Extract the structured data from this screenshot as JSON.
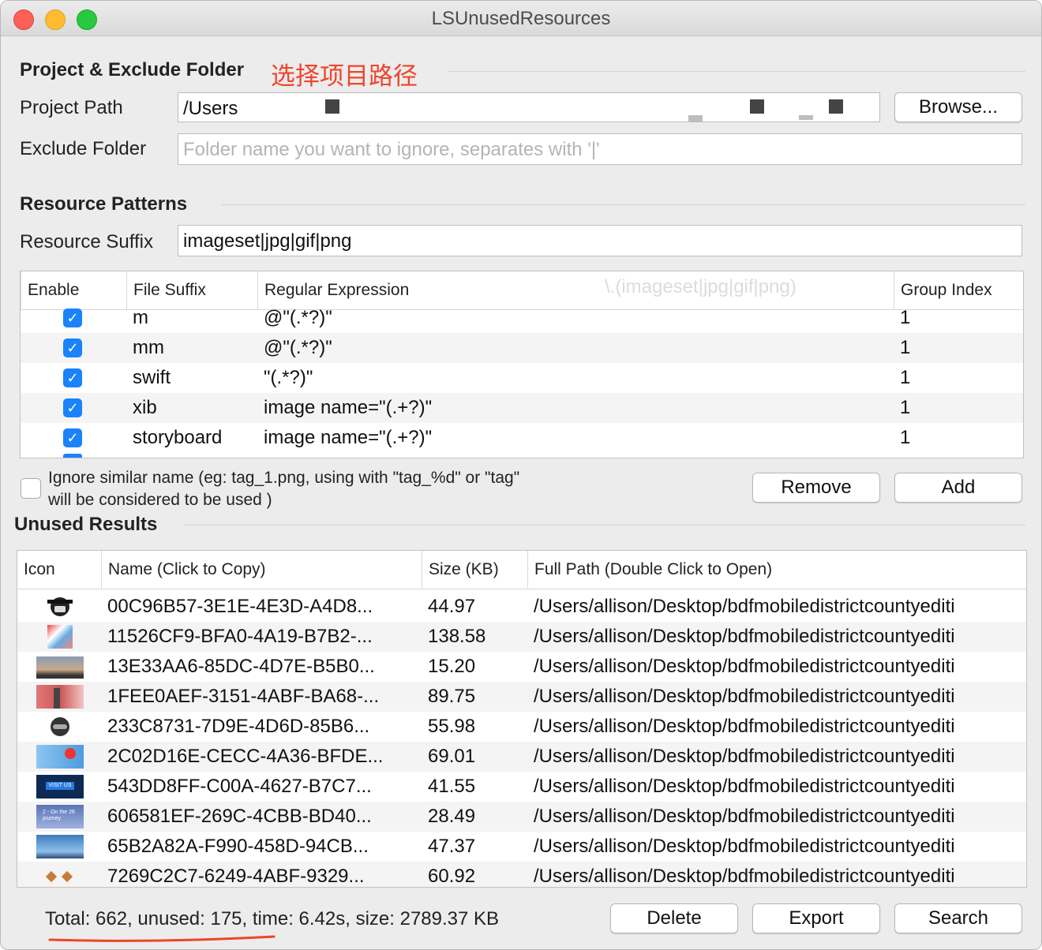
{
  "window": {
    "title": "LSUnusedResources"
  },
  "project": {
    "section_title": "Project & Exclude Folder",
    "annotation": "选择项目路径",
    "project_path_label": "Project Path",
    "project_path_value": "/Users",
    "browse_label": "Browse...",
    "exclude_label": "Exclude Folder",
    "exclude_placeholder": "Folder name you want to ignore, separates with '|'"
  },
  "patterns": {
    "section_title": "Resource Patterns",
    "suffix_label": "Resource Suffix",
    "suffix_value": "imageset|jpg|gif|png",
    "columns": [
      "Enable",
      "File Suffix",
      "Regular Expression",
      "Group Index"
    ],
    "header_ghost": "\\.(imageset|jpg|gif|png)",
    "rows": [
      {
        "enabled": true,
        "suffix": "m",
        "regex": "@\"(.*?)\"",
        "group": "1"
      },
      {
        "enabled": true,
        "suffix": "mm",
        "regex": "@\"(.*?)\"",
        "group": "1"
      },
      {
        "enabled": true,
        "suffix": "swift",
        "regex": "\"(.*?)\"",
        "group": "1"
      },
      {
        "enabled": true,
        "suffix": "xib",
        "regex": "image name=\"(.+?)\"",
        "group": "1"
      },
      {
        "enabled": true,
        "suffix": "storyboard",
        "regex": "image name=\"(.+?)\"",
        "group": "1"
      }
    ],
    "ignore_similar_line1": "Ignore similar name (eg: tag_1.png, using with \"tag_%d\" or \"tag\"",
    "ignore_similar_line2": "will be considered to be used )",
    "remove_label": "Remove",
    "add_label": "Add"
  },
  "results": {
    "section_title": "Unused Results",
    "columns": [
      "Icon",
      "Name (Click to Copy)",
      "Size (KB)",
      "Full Path (Double Click to Open)"
    ],
    "rows": [
      {
        "icon": "hat-figure-icon",
        "name": "00C96B57-3E1E-4E3D-A4D8...",
        "size": "44.97",
        "path": "/Users/allison/Desktop/bdfmobiledistrictcountyediti"
      },
      {
        "icon": "collage-thumbnail-icon",
        "name": "11526CF9-BFA0-4A19-B7B2-...",
        "size": "138.58",
        "path": "/Users/allison/Desktop/bdfmobiledistrictcountyediti"
      },
      {
        "icon": "sunset-thumbnail-icon",
        "name": "13E33AA6-85DC-4D7E-B5B0...",
        "size": "15.20",
        "path": "/Users/allison/Desktop/bdfmobiledistrictcountyediti"
      },
      {
        "icon": "tower-thumbnail-icon",
        "name": "1FEE0AEF-3151-4ABF-BA68-...",
        "size": "89.75",
        "path": "/Users/allison/Desktop/bdfmobiledistrictcountyediti"
      },
      {
        "icon": "helmet-figure-icon",
        "name": "233C8731-7D9E-4D6D-85B6...",
        "size": "55.98",
        "path": "/Users/allison/Desktop/bdfmobiledistrictcountyediti"
      },
      {
        "icon": "flowers-thumbnail-icon",
        "name": "2C02D16E-CECC-4A36-BFDE...",
        "size": "69.01",
        "path": "/Users/allison/Desktop/bdfmobiledistrictcountyediti"
      },
      {
        "icon": "visit-us-thumbnail-icon",
        "name": "543DD8FF-C00A-4627-B7C7...",
        "size": "41.55",
        "path": "/Users/allison/Desktop/bdfmobiledistrictcountyediti"
      },
      {
        "icon": "journey-thumbnail-icon",
        "name": "606581EF-269C-4CBB-BD40...",
        "size": "28.49",
        "path": "/Users/allison/Desktop/bdfmobiledistrictcountyediti"
      },
      {
        "icon": "banner-thumbnail-icon",
        "name": "65B2A82A-F990-458D-94CB...",
        "size": "47.37",
        "path": "/Users/allison/Desktop/bdfmobiledistrictcountyediti"
      },
      {
        "icon": "birds-thumbnail-icon",
        "name": "7269C2C7-6249-4ABF-9329...",
        "size": "60.92",
        "path": "/Users/allison/Desktop/bdfmobiledistrictcountyediti"
      }
    ],
    "thumb_text_visit": "VISIT US",
    "thumb_text_journey": "2 - On the 26 journey",
    "status": "Total: 662, unused: 175, time: 6.42s, size: 2789.37 KB",
    "delete_label": "Delete",
    "export_label": "Export",
    "search_label": "Search"
  },
  "colors": {
    "accent": "#1a82fb",
    "annotation": "#f0442c"
  }
}
